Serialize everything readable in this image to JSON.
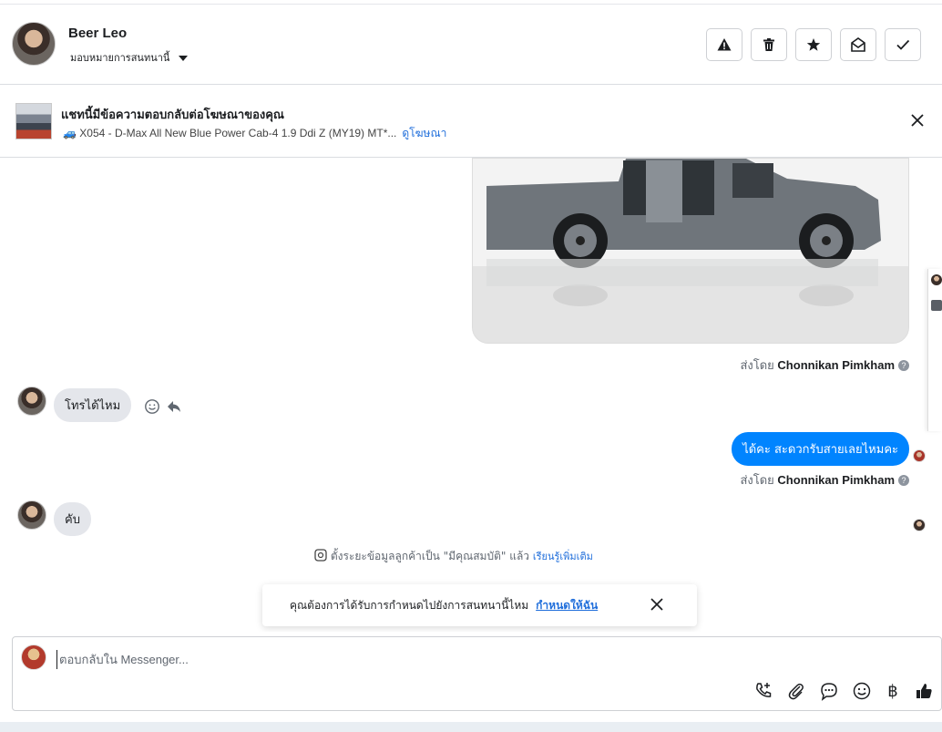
{
  "header": {
    "contact_name": "Beer Leo",
    "assign_label": "มอบหมายการสนทนานี้",
    "buttons": [
      "warning-icon",
      "trash-icon",
      "star-icon",
      "mark-unread-icon",
      "check-icon"
    ]
  },
  "ad_banner": {
    "title": "แชทนี้มีข้อความตอบกลับต่อโฆษณาของคุณ",
    "subtitle": "🚙 X054 - D-Max All New Blue Power Cab-4 1.9 Ddi Z (MY19) MT*...",
    "link": "ดูโฆษณา"
  },
  "messages": {
    "sent_by_prefix": "ส่งโดย",
    "agent_name": "Chonnikan Pimkham",
    "help": "?",
    "incoming_1": "โทรได้ไหม",
    "outgoing_1": "ได้คะ สะดวกรับสายเลยไหมคะ",
    "incoming_2": "คับ"
  },
  "system_message": {
    "text": "ตั้งระยะข้อมูลลูกค้าเป็น \"มีคุณสมบัติ\" แล้ว",
    "link": "เรียนรู้เพิ่มเติม"
  },
  "toast": {
    "text": "คุณต้องการได้รับการกำหนดไปยังการสนทนานี้ไหม",
    "link": "กำหนดให้ฉัน"
  },
  "composer": {
    "placeholder": "ตอบกลับใน Messenger...",
    "tools": [
      "phone-add-icon",
      "paperclip-icon",
      "chat-bubble-icon",
      "emoji-icon",
      "baht-icon",
      "thumbs-up-icon"
    ],
    "baht_symbol": "฿"
  }
}
